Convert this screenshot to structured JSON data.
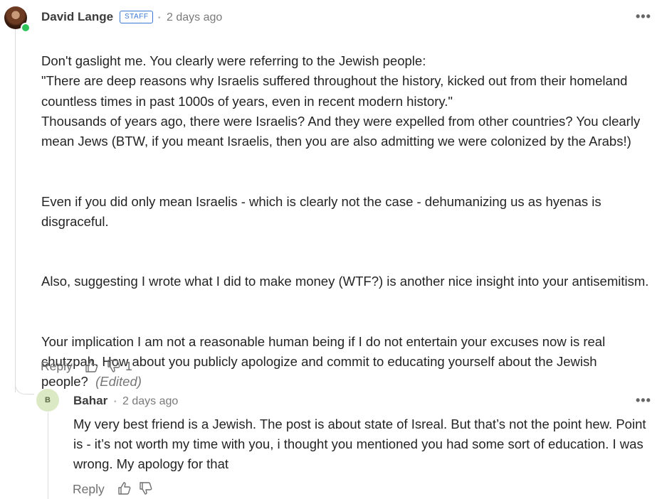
{
  "comment": {
    "author": "David Lange",
    "badge": "STAFF",
    "time": "2 days ago",
    "paragraphs": [
      "Don't gaslight me. You clearly were referring to the Jewish people:\n\"There are deep reasons why Israelis suffered throughout the history, kicked out from their homeland countless times in past 1000s of years, even in recent modern history.\"\nThousands of years ago, there were Israelis? And they were expelled from other countries? You clearly mean Jews (BTW, if you meant Israelis, then you are also admitting we were colonized by the Arabs!)",
      "Even if you did only mean Israelis - which is clearly not the case - dehumanizing us as hyenas is disgraceful.",
      "Also, suggesting I wrote what I did to make money (WTF?) is another nice insight into your antisemitism.",
      "Your implication I am not a reasonable human being if I do not entertain your excuses now is real chutzpah. How about you publicly apologize and commit to educating yourself about the Jewish people?"
    ],
    "edited_label": "(Edited)",
    "reply_label": "Reply",
    "dislike_count": "1",
    "more_label": "•••"
  },
  "reply": {
    "avatar_letter": "B",
    "author": "Bahar",
    "time": "2 days ago",
    "text": "My very best friend is a Jewish. The post is about state of Isreal.  But that’s not the point hew. Point is - it’s not worth my time with you, i thought you mentioned you had some sort of education. I was wrong. My apology for that",
    "reply_label": "Reply",
    "more_label": "•••"
  },
  "separator": "•",
  "icons": [
    "thumbs-up-icon",
    "thumbs-down-icon",
    "more-icon"
  ]
}
